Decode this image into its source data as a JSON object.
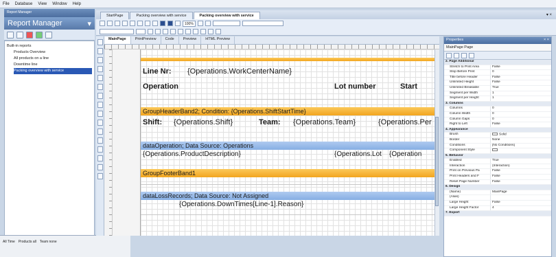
{
  "menu": [
    "File",
    "Database",
    "View",
    "Window",
    "Help"
  ],
  "left_panel": {
    "title": "Report Manager",
    "header": "Report Manager",
    "tree": [
      "Built-in reports",
      "Products Overview",
      "All products on a line",
      "Downtime line",
      "Packing overview with service"
    ]
  },
  "bottom_bar": {
    "left": "All Time",
    "products": "Products all",
    "teams": "Team none"
  },
  "tabs": [
    "StartPage",
    "Packing overview with service",
    "Packing overview with service"
  ],
  "toolbar": {
    "zoom": "100%"
  },
  "designer_tabs": [
    "MainPage",
    "PrintPreview",
    "Code",
    "Preview",
    "HTML Preview"
  ],
  "report": {
    "line_label": "Line Nr:",
    "line_value": "{Operations.WorkCenterName}",
    "col_operation": "Operation",
    "col_lot": "Lot number",
    "col_start": "Start",
    "group_header": "GroupHeaderBand2; Condition: {Operations.ShiftStartTime}",
    "shift_label": "Shift:",
    "shift_value": "{Operations.Shift}",
    "team_label": "Team:",
    "team_value": "{Operations.Team}",
    "team_value2": "{Operations.Per",
    "data_band": "dataOperation; Data Source: Operations",
    "product_desc": "{Operations.ProductDescription}",
    "lot_value": "{Operations.Lot",
    "oper_value": "{Operation",
    "group_footer": "GroupFooterBand1",
    "loss_band": "dataLossRecords; Data Source: Not Assigned",
    "reason_value": "{Operations.DownTimes[Line-1].Reason}"
  },
  "properties": {
    "title": "Properties",
    "selected": "MainPage  Page",
    "rows": [
      {
        "type": "cat",
        "k": "2. Page Additional"
      },
      {
        "k": "Stretch to Print Area",
        "v": "False"
      },
      {
        "k": "Stop Before Print",
        "v": "0"
      },
      {
        "k": "Title before Header",
        "v": "False"
      },
      {
        "k": "Unlimited Height",
        "v": "False"
      },
      {
        "k": "Unlimited Breakable",
        "v": "True"
      },
      {
        "k": "Segment per Width",
        "v": "1"
      },
      {
        "k": "Segment per Height",
        "v": "1"
      },
      {
        "type": "cat",
        "k": "3. Columns"
      },
      {
        "k": "Columns",
        "v": "0"
      },
      {
        "k": "Column Width",
        "v": "0"
      },
      {
        "k": "Column Gaps",
        "v": "0"
      },
      {
        "k": "Right to Left",
        "v": "False"
      },
      {
        "type": "cat",
        "k": "4. Appearance"
      },
      {
        "k": "Brush",
        "v": "Solid",
        "sw": true
      },
      {
        "k": "Border",
        "v": "None"
      },
      {
        "k": "Conditions",
        "v": "[No Conditions]"
      },
      {
        "k": "Component Style",
        "v": "",
        "sw": true
      },
      {
        "type": "cat",
        "k": "5. Behavior"
      },
      {
        "k": "Enabled",
        "v": "True"
      },
      {
        "k": "Interaction",
        "v": "(Interaction)"
      },
      {
        "k": "Print on Previous Pa",
        "v": "False"
      },
      {
        "k": "Print Headers and F",
        "v": "False"
      },
      {
        "k": "Reset Page Number",
        "v": "False"
      },
      {
        "type": "cat",
        "k": "6. Design"
      },
      {
        "k": "(Name)",
        "v": "MainPage"
      },
      {
        "k": "(Alias)",
        "v": ""
      },
      {
        "k": "Large Height",
        "v": "False"
      },
      {
        "k": "Large Height Factor",
        "v": "4"
      },
      {
        "type": "cat",
        "k": "7. Export"
      }
    ]
  }
}
